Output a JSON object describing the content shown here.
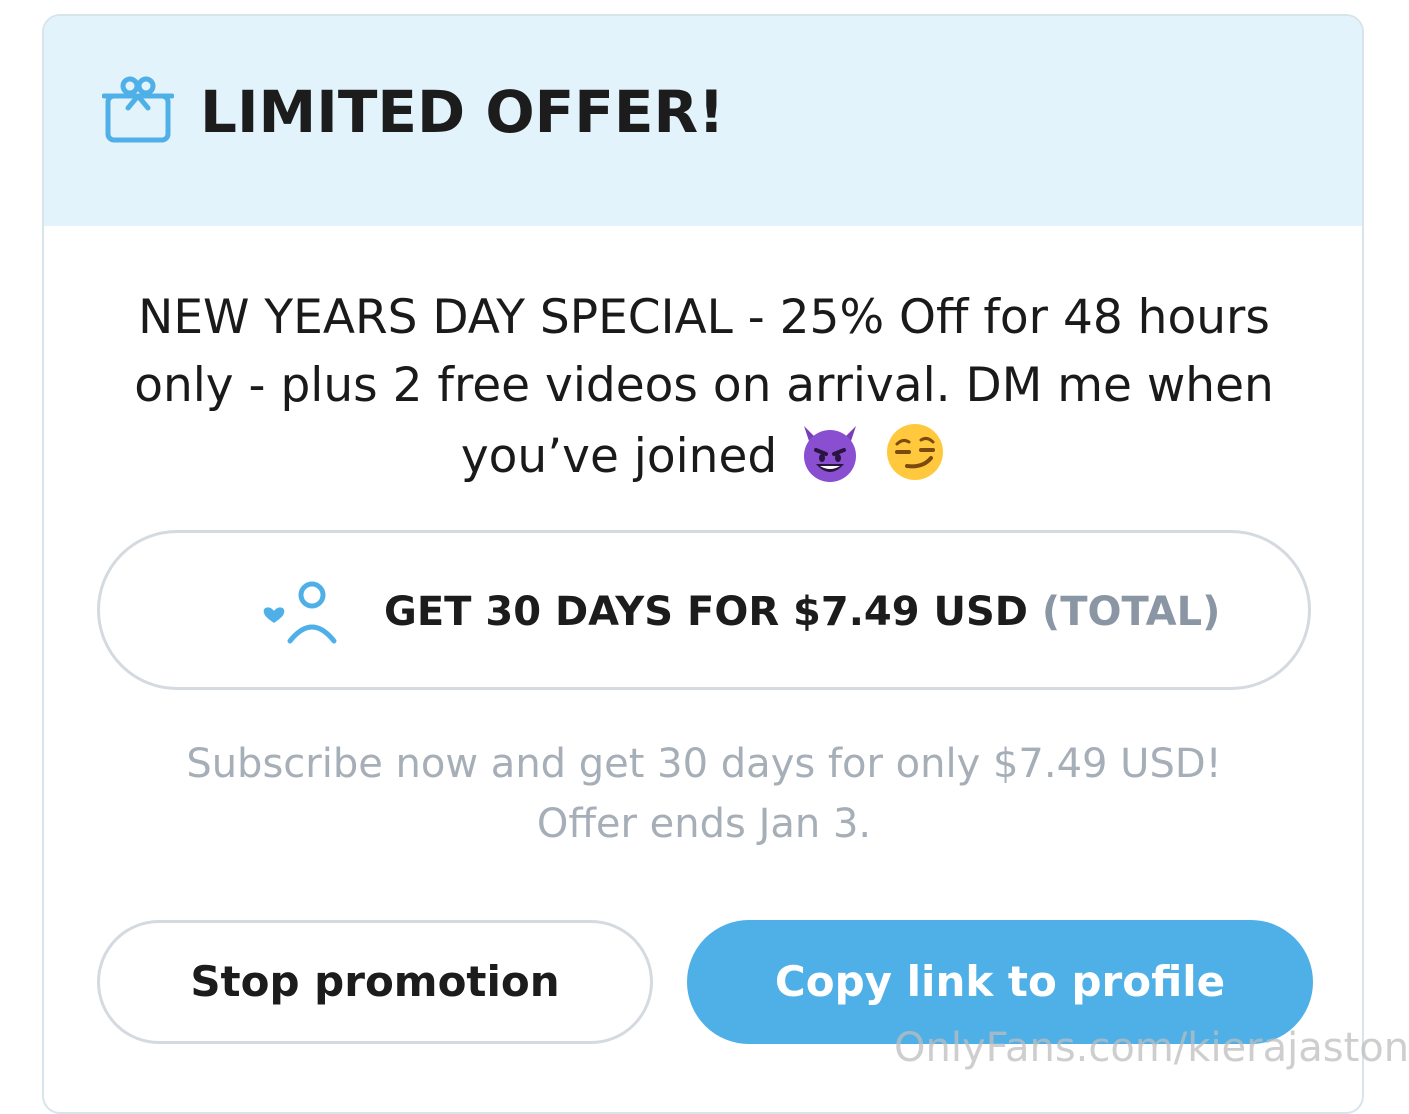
{
  "header": {
    "title": "LIMITED OFFER!",
    "icon": "gift-icon"
  },
  "description": {
    "line1": "NEW YEARS DAY SPECIAL - 25% Off for 48 hours",
    "line2": "only - plus 2 free videos on arrival. DM me when",
    "line3": "you’ve joined",
    "emojis": [
      "smiling-devil-emoji",
      "smirking-face-emoji"
    ]
  },
  "subscribe_button": {
    "label": "GET 30 DAYS FOR $7.49 USD",
    "suffix": "(TOTAL)",
    "icon": "subscribe-user-heart-icon"
  },
  "subtext": {
    "line1": "Subscribe now and get 30 days for only $7.49 USD!",
    "line2": "Offer ends Jan 3."
  },
  "actions": {
    "stop_label": "Stop promotion",
    "copy_label": "Copy link to profile"
  },
  "watermark": "OnlyFans.com/kierajaston",
  "colors": {
    "header_bg": "#e3f3fb",
    "accent": "#4fb0e8",
    "muted_text": "#a6aeb8",
    "border": "#d4dadf"
  }
}
